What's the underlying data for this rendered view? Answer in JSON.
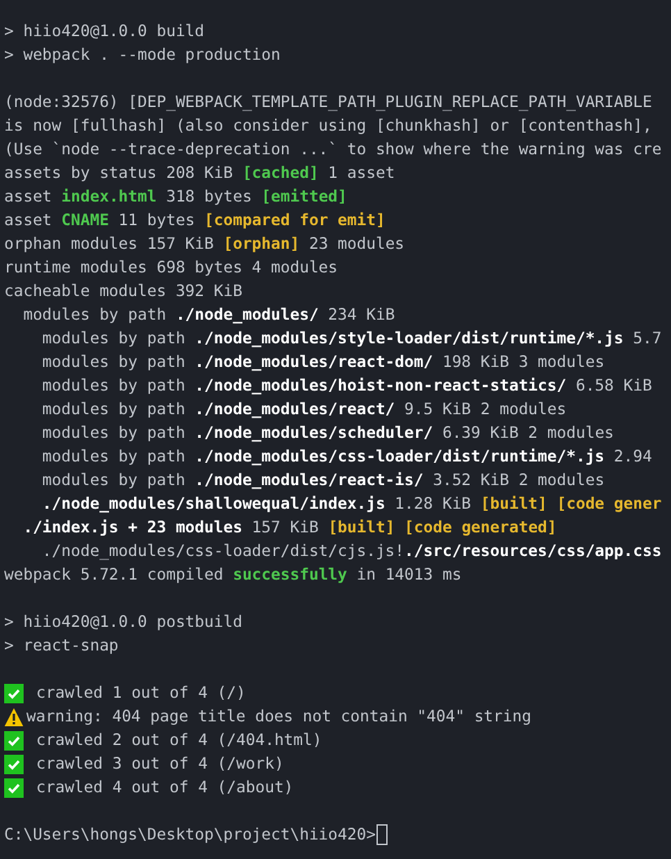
{
  "blocks": [
    {
      "lines": [
        {
          "kind": "text",
          "segments": [
            {
              "text": "> hiio420@1.0.0 build",
              "kind": "text"
            }
          ]
        },
        {
          "kind": "text",
          "segments": [
            {
              "text": "> webpack . --mode production",
              "kind": "text"
            }
          ]
        }
      ]
    },
    {
      "lines": [
        {
          "kind": "text",
          "segments": [
            {
              "text": "(node:32576) [DEP_WEBPACK_TEMPLATE_PATH_PLUGIN_REPLACE_PATH_VARIABLE",
              "kind": "text"
            }
          ]
        },
        {
          "kind": "text",
          "segments": [
            {
              "text": "is now [fullhash] (also consider using [chunkhash] or [contenthash],",
              "kind": "text"
            }
          ]
        },
        {
          "kind": "text",
          "segments": [
            {
              "text": "(Use `node --trace-deprecation ...` to show where the warning was cre",
              "kind": "text"
            }
          ]
        },
        {
          "kind": "text",
          "segments": [
            {
              "text": "assets by status 208 KiB ",
              "kind": "text"
            },
            {
              "text": "[cached]",
              "kind": "ok"
            },
            {
              "text": " 1 asset",
              "kind": "text"
            }
          ]
        },
        {
          "kind": "text",
          "segments": [
            {
              "text": "asset ",
              "kind": "text"
            },
            {
              "text": "index.html",
              "kind": "ok"
            },
            {
              "text": " 318 bytes ",
              "kind": "text"
            },
            {
              "text": "[emitted]",
              "kind": "ok"
            }
          ]
        },
        {
          "kind": "text",
          "segments": [
            {
              "text": "asset ",
              "kind": "text"
            },
            {
              "text": "CNAME",
              "kind": "ok"
            },
            {
              "text": " 11 bytes ",
              "kind": "text"
            },
            {
              "text": "[compared for emit]",
              "kind": "tag"
            }
          ]
        },
        {
          "kind": "text",
          "segments": [
            {
              "text": "orphan modules 157 KiB ",
              "kind": "text"
            },
            {
              "text": "[orphan]",
              "kind": "tag"
            },
            {
              "text": " 23 modules",
              "kind": "text"
            }
          ]
        },
        {
          "kind": "text",
          "segments": [
            {
              "text": "runtime modules 698 bytes 4 modules",
              "kind": "text"
            }
          ]
        },
        {
          "kind": "text",
          "segments": [
            {
              "text": "cacheable modules 392 KiB",
              "kind": "text"
            }
          ]
        },
        {
          "kind": "text",
          "segments": [
            {
              "text": "  modules by path ",
              "kind": "text"
            },
            {
              "text": "./node_modules/",
              "kind": "path"
            },
            {
              "text": " 234 KiB",
              "kind": "text"
            }
          ]
        },
        {
          "kind": "text",
          "segments": [
            {
              "text": "    modules by path ",
              "kind": "text"
            },
            {
              "text": "./node_modules/style-loader/dist/runtime/*.js",
              "kind": "path"
            },
            {
              "text": " 5.7",
              "kind": "text"
            }
          ]
        },
        {
          "kind": "text",
          "segments": [
            {
              "text": "    modules by path ",
              "kind": "text"
            },
            {
              "text": "./node_modules/react-dom/",
              "kind": "path"
            },
            {
              "text": " 198 KiB 3 modules",
              "kind": "text"
            }
          ]
        },
        {
          "kind": "text",
          "segments": [
            {
              "text": "    modules by path ",
              "kind": "text"
            },
            {
              "text": "./node_modules/hoist-non-react-statics/",
              "kind": "path"
            },
            {
              "text": " 6.58 KiB",
              "kind": "text"
            }
          ]
        },
        {
          "kind": "text",
          "segments": [
            {
              "text": "    modules by path ",
              "kind": "text"
            },
            {
              "text": "./node_modules/react/",
              "kind": "path"
            },
            {
              "text": " 9.5 KiB 2 modules",
              "kind": "text"
            }
          ]
        },
        {
          "kind": "text",
          "segments": [
            {
              "text": "    modules by path ",
              "kind": "text"
            },
            {
              "text": "./node_modules/scheduler/",
              "kind": "path"
            },
            {
              "text": " 6.39 KiB 2 modules",
              "kind": "text"
            }
          ]
        },
        {
          "kind": "text",
          "segments": [
            {
              "text": "    modules by path ",
              "kind": "text"
            },
            {
              "text": "./node_modules/css-loader/dist/runtime/*.js",
              "kind": "path"
            },
            {
              "text": " 2.94",
              "kind": "text"
            }
          ]
        },
        {
          "kind": "text",
          "segments": [
            {
              "text": "    modules by path ",
              "kind": "text"
            },
            {
              "text": "./node_modules/react-is/",
              "kind": "path"
            },
            {
              "text": " 3.52 KiB 2 modules",
              "kind": "text"
            }
          ]
        },
        {
          "kind": "text",
          "segments": [
            {
              "text": "    ./node_modules/shallowequal/index.js",
              "kind": "path"
            },
            {
              "text": " 1.28 KiB ",
              "kind": "text"
            },
            {
              "text": "[built] [code gener",
              "kind": "tag"
            }
          ]
        },
        {
          "kind": "text",
          "segments": [
            {
              "text": "  ./index.js + 23 modules",
              "kind": "path"
            },
            {
              "text": " 157 KiB ",
              "kind": "text"
            },
            {
              "text": "[built] [code generated]",
              "kind": "tag"
            }
          ]
        },
        {
          "kind": "text",
          "segments": [
            {
              "text": "    ./node_modules/css-loader/dist/cjs.js!",
              "kind": "text"
            },
            {
              "text": "./src/resources/css/app.css",
              "kind": "path"
            }
          ]
        },
        {
          "kind": "text",
          "segments": [
            {
              "text": "webpack 5.72.1 compiled ",
              "kind": "text"
            },
            {
              "text": "successfully",
              "kind": "ok"
            },
            {
              "text": " in 14013 ms",
              "kind": "text"
            }
          ]
        }
      ]
    },
    {
      "lines": [
        {
          "kind": "text",
          "segments": [
            {
              "text": "> hiio420@1.0.0 postbuild",
              "kind": "text"
            }
          ]
        },
        {
          "kind": "text",
          "segments": [
            {
              "text": "> react-snap",
              "kind": "text"
            }
          ]
        }
      ]
    },
    {
      "lines": [
        {
          "kind": "success",
          "segments": [
            {
              "text": "crawled 1 out of 4 (/)",
              "kind": "text"
            }
          ]
        },
        {
          "kind": "warning",
          "segments": [
            {
              "text": "warning: 404 page title does not contain \"404\" string",
              "kind": "text"
            }
          ]
        },
        {
          "kind": "success",
          "segments": [
            {
              "text": "crawled 2 out of 4 (/404.html)",
              "kind": "text"
            }
          ]
        },
        {
          "kind": "success",
          "segments": [
            {
              "text": "crawled 3 out of 4 (/work)",
              "kind": "text"
            }
          ]
        },
        {
          "kind": "success",
          "segments": [
            {
              "text": "crawled 4 out of 4 (/about)",
              "kind": "text"
            }
          ]
        }
      ]
    },
    {
      "lines": [
        {
          "kind": "prompt",
          "segments": [
            {
              "text": "C:\\Users\\hongs\\Desktop\\project\\hiio420>",
              "kind": "text"
            }
          ]
        }
      ]
    }
  ]
}
